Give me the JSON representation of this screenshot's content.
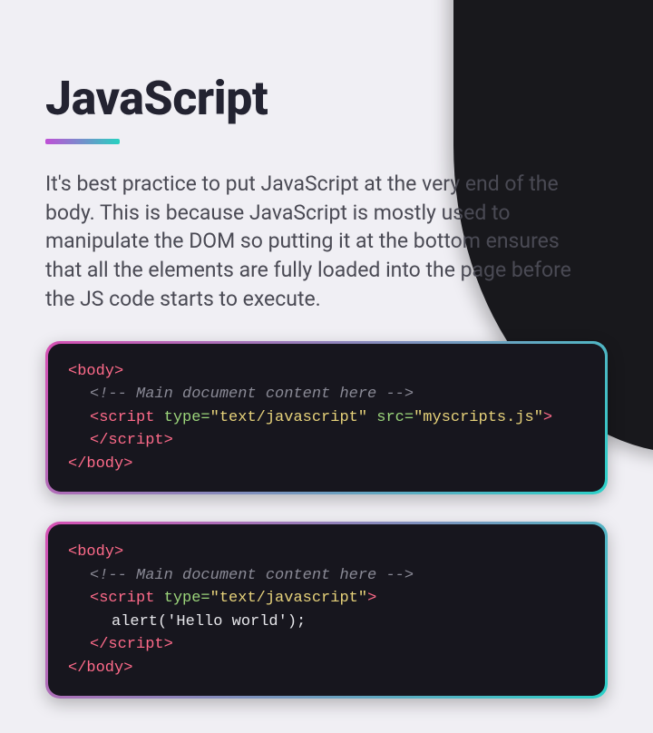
{
  "title": "JavaScript",
  "paragraph": "It's best practice to put JavaScript at the very end of the body. This is because JavaScript is mostly used to manipulate the DOM so putting it at the bottom ensures that all the elements are fully loaded into the page before the JS code starts to execute.",
  "code1": {
    "l1_tag": "<body>",
    "l2_comment": "<!-- Main document content here -->",
    "l3_tag_open": "<script",
    "l3_attr1_name": " type=",
    "l3_attr1_val": "\"text/javascript\"",
    "l3_attr2_name": " src=",
    "l3_attr2_val": "\"myscripts.js\"",
    "l3_tag_close": ">",
    "l4_tag": "</script>",
    "l5_tag": "</body>"
  },
  "code2": {
    "l1_tag": "<body>",
    "l2_comment": "<!-- Main document content here -->",
    "l3_tag_open": "<script",
    "l3_attr1_name": " type=",
    "l3_attr1_val": "\"text/javascript\"",
    "l3_tag_close": ">",
    "l4_code": "alert('Hello world');",
    "l5_tag": "</script>",
    "l6_tag": "</body>"
  }
}
